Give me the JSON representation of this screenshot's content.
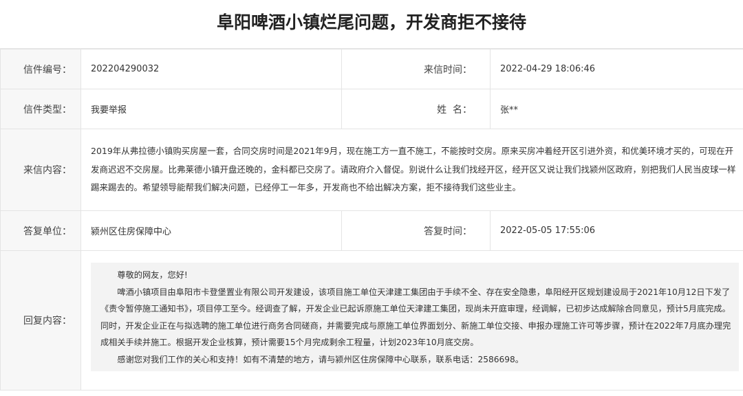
{
  "title": "阜阳啤酒小镇烂尾问题，开发商拒不接待",
  "labels": {
    "letter_no": "信件编号：",
    "received_time": "来信时间：",
    "letter_type": "信件类型：",
    "name": "姓  名：",
    "content": "来信内容：",
    "reply_unit": "答复单位：",
    "reply_time": "答复时间：",
    "reply_content": "回复内容："
  },
  "values": {
    "letter_no": "202204290032",
    "received_time": "2022-04-29 18:06:46",
    "letter_type": "我要举报",
    "name": "张**",
    "content": "2019年从弗拉德小镇购买房屋一套，合同交房时间是2021年9月，现在施工方一直不施工，不能按时交房。原来买房冲着经开区引进外资，和优美环境才买的，可现在开发商迟迟不交房屋。比弗莱德小镇开盘还晚的，金科都已交房了。请政府介入督促。别说什么让我们找经开区，经开区又说让我们找颍州区政府，别把我们人民当皮球一样踢来踢去的。希望领导能帮我们解决问题，已经停工一年多，开发商也不给出解决方案，拒不接待我们这些业主。",
    "reply_unit": "颍州区住房保障中心",
    "reply_time": "2022-05-05 17:55:06"
  },
  "reply": {
    "greeting": "尊敬的网友，您好!",
    "body": "啤酒小镇项目由阜阳市卡登堡置业有限公司开发建设，该项目施工单位天津建工集团由于手续不全、存在安全隐患，阜阳经开区规划建设局于2021年10月12日下发了《责令暂停施工通知书》，项目停工至今。经调查了解，开发企业已起诉原施工单位天津建工集团，现尚未开庭审理，经调解，已初步达成解除合同意见，预计5月底完成。同时，开发企业正在与拟选聘的施工单位进行商务合同磋商，并需要完成与原施工单位界面划分、新施工单位交接、申报办理施工许可等步骤，预计在2022年7月底办理完成相关手续并施工。根据开发企业核算，预计需要15个月完成剩余工程量，计划2023年10月底交房。",
    "closing": "感谢您对我们工作的关心和支持！如有不清楚的地方，请与颍州区住房保障中心联系，联系电话：2586698。"
  }
}
